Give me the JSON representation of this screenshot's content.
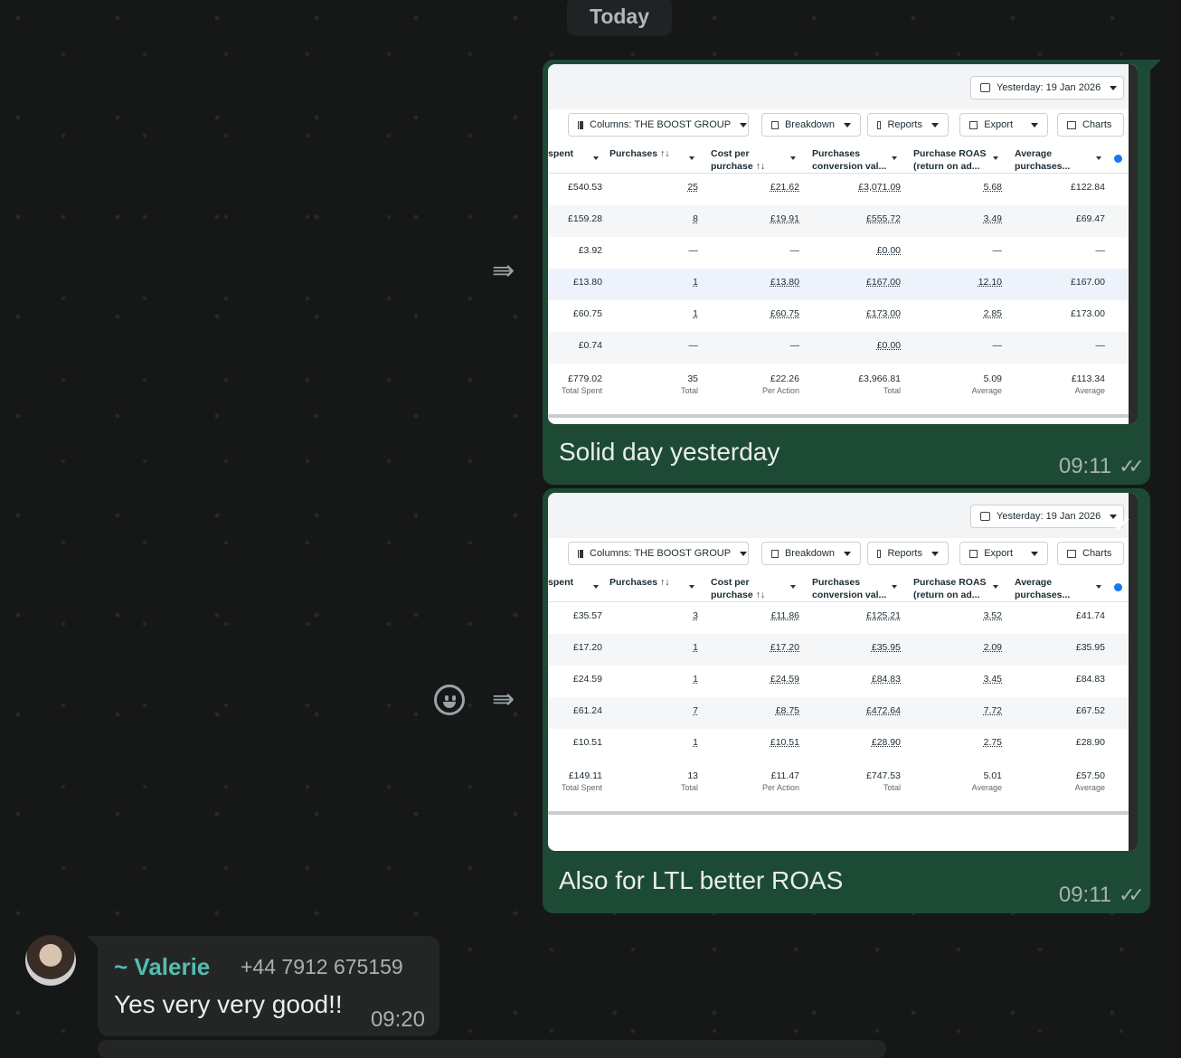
{
  "date_divider": "Today",
  "messages": [
    {
      "caption": "Solid day yesterday",
      "time": "09:11",
      "screenshot": {
        "date_range": "Yesterday: 19 Jan 2026",
        "toolbar": {
          "columns": "Columns: THE BOOST GROUP",
          "breakdown": "Breakdown",
          "reports": "Reports",
          "export": "Export",
          "charts": "Charts"
        },
        "headers": [
          [
            "spent",
            ""
          ],
          [
            "Purchases ↑↓",
            ""
          ],
          [
            "Cost per",
            "purchase ↑↓"
          ],
          [
            "Purchases",
            "conversion val..."
          ],
          [
            "Purchase ROAS",
            "(return on ad..."
          ],
          [
            "Average",
            "purchases..."
          ]
        ],
        "rows": [
          [
            "£540.53",
            "25",
            "£21.62",
            "£3,071.09",
            "5.68",
            "£122.84"
          ],
          [
            "£159.28",
            "8",
            "£19.91",
            "£555.72",
            "3.49",
            "£69.47"
          ],
          [
            "£3.92",
            "—",
            "—",
            "£0.00",
            "—",
            "—"
          ],
          [
            "£13.80",
            "1",
            "£13.80",
            "£167.00",
            "12.10",
            "£167.00"
          ],
          [
            "£60.75",
            "1",
            "£60.75",
            "£173.00",
            "2.85",
            "£173.00"
          ],
          [
            "£0.74",
            "—",
            "—",
            "£0.00",
            "—",
            "—"
          ]
        ],
        "totals": [
          "£779.02",
          "35",
          "£22.26",
          "£3,966.81",
          "5.09",
          "£113.34"
        ],
        "total_labels": [
          "Total Spent",
          "Total",
          "Per Action",
          "Total",
          "Average",
          "Average"
        ]
      }
    },
    {
      "caption": "Also for LTL better ROAS",
      "time": "09:11",
      "screenshot": {
        "date_range": "Yesterday: 19 Jan 2026",
        "toolbar": {
          "columns": "Columns: THE BOOST GROUP",
          "breakdown": "Breakdown",
          "reports": "Reports",
          "export": "Export",
          "charts": "Charts"
        },
        "headers": [
          [
            "spent",
            ""
          ],
          [
            "Purchases ↑↓",
            ""
          ],
          [
            "Cost per",
            "purchase ↑↓"
          ],
          [
            "Purchases",
            "conversion val..."
          ],
          [
            "Purchase ROAS",
            "(return on ad..."
          ],
          [
            "Average",
            "purchases..."
          ]
        ],
        "rows": [
          [
            "£35.57",
            "3",
            "£11.86",
            "£125.21",
            "3.52",
            "£41.74"
          ],
          [
            "£17.20",
            "1",
            "£17.20",
            "£35.95",
            "2.09",
            "£35.95"
          ],
          [
            "£24.59",
            "1",
            "£24.59",
            "£84.83",
            "3.45",
            "£84.83"
          ],
          [
            "£61.24",
            "7",
            "£8.75",
            "£472.64",
            "7.72",
            "£67.52"
          ],
          [
            "£10.51",
            "1",
            "£10.51",
            "£28.90",
            "2.75",
            "£28.90"
          ]
        ],
        "totals": [
          "£149.11",
          "13",
          "£11.47",
          "£747.53",
          "5.01",
          "£57.50"
        ],
        "total_labels": [
          "Total Spent",
          "Total",
          "Per Action",
          "Total",
          "Average",
          "Average"
        ]
      }
    }
  ],
  "incoming": {
    "sender": "~ Valerie",
    "phone": "+44 7912 675159",
    "text": "Yes very very good!!",
    "time": "09:20"
  },
  "icons": {
    "forward": "forward-icon",
    "emoji": "emoji-icon",
    "read_receipt": "double-check-icon",
    "dropdown": "chevron-down-icon"
  }
}
